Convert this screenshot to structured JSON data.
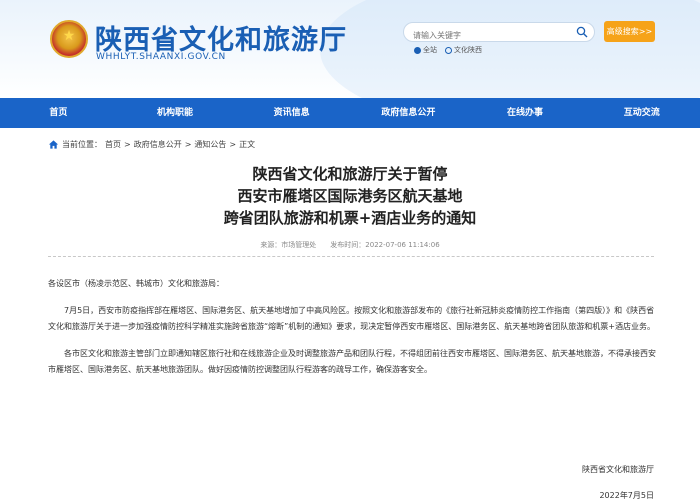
{
  "header": {
    "site_title": "陕西省文化和旅游厅",
    "site_url": "WHHLYT.SHAANXI.GOV.CN",
    "search_placeholder": "请输入关键字",
    "advanced_search": "高级搜索>>",
    "search_scope": [
      "全站",
      "文化陕西"
    ]
  },
  "nav": {
    "items": [
      "首页",
      "机构职能",
      "资讯信息",
      "政府信息公开",
      "在线办事",
      "互动交流"
    ]
  },
  "breadcrumb": {
    "label": "当前位置：",
    "items": [
      "首页",
      ">",
      "政府信息公开",
      ">",
      "通知公告",
      ">",
      "正文"
    ]
  },
  "article": {
    "title_lines": [
      "陕西省文化和旅游厅关于暂停",
      "西安市雁塔区国际港务区航天基地",
      "跨省团队旅游和机票+酒店业务的通知"
    ],
    "meta": "来源：市场管理处　　发布时间：2022-07-06 11:14:06",
    "salutation": "各设区市（杨凌示范区、韩城市）文化和旅游局：",
    "paragraphs": [
      "7月5日，西安市防疫指挥部在雁塔区、国际港务区、航天基地增加了中高风险区。按照文化和旅游部发布的《旅行社新冠肺炎疫情防控工作指南（第四版）》和《陕西省文化和旅游厅关于进一步加强疫情防控科学精准实施跨省旅游“熔断”机制的通知》要求，现决定暂停西安市雁塔区、国际港务区、航天基地跨省团队旅游和机票+酒店业务。",
      "各市区文化和旅游主管部门立即通知辖区旅行社和在线旅游企业及时调整旅游产品和团队行程，不得组团前往西安市雁塔区、国际港务区、航天基地旅游，不得承接西安市雁塔区、国际港务区、航天基地旅游团队。做好因疫情防控调整团队行程游客的疏导工作，确保游客安全。"
    ],
    "signature": "陕西省文化和旅游厅",
    "date": "2022年7月5日"
  },
  "colors": {
    "brand_blue": "#1a64c8",
    "accent_orange": "#f6a319"
  }
}
